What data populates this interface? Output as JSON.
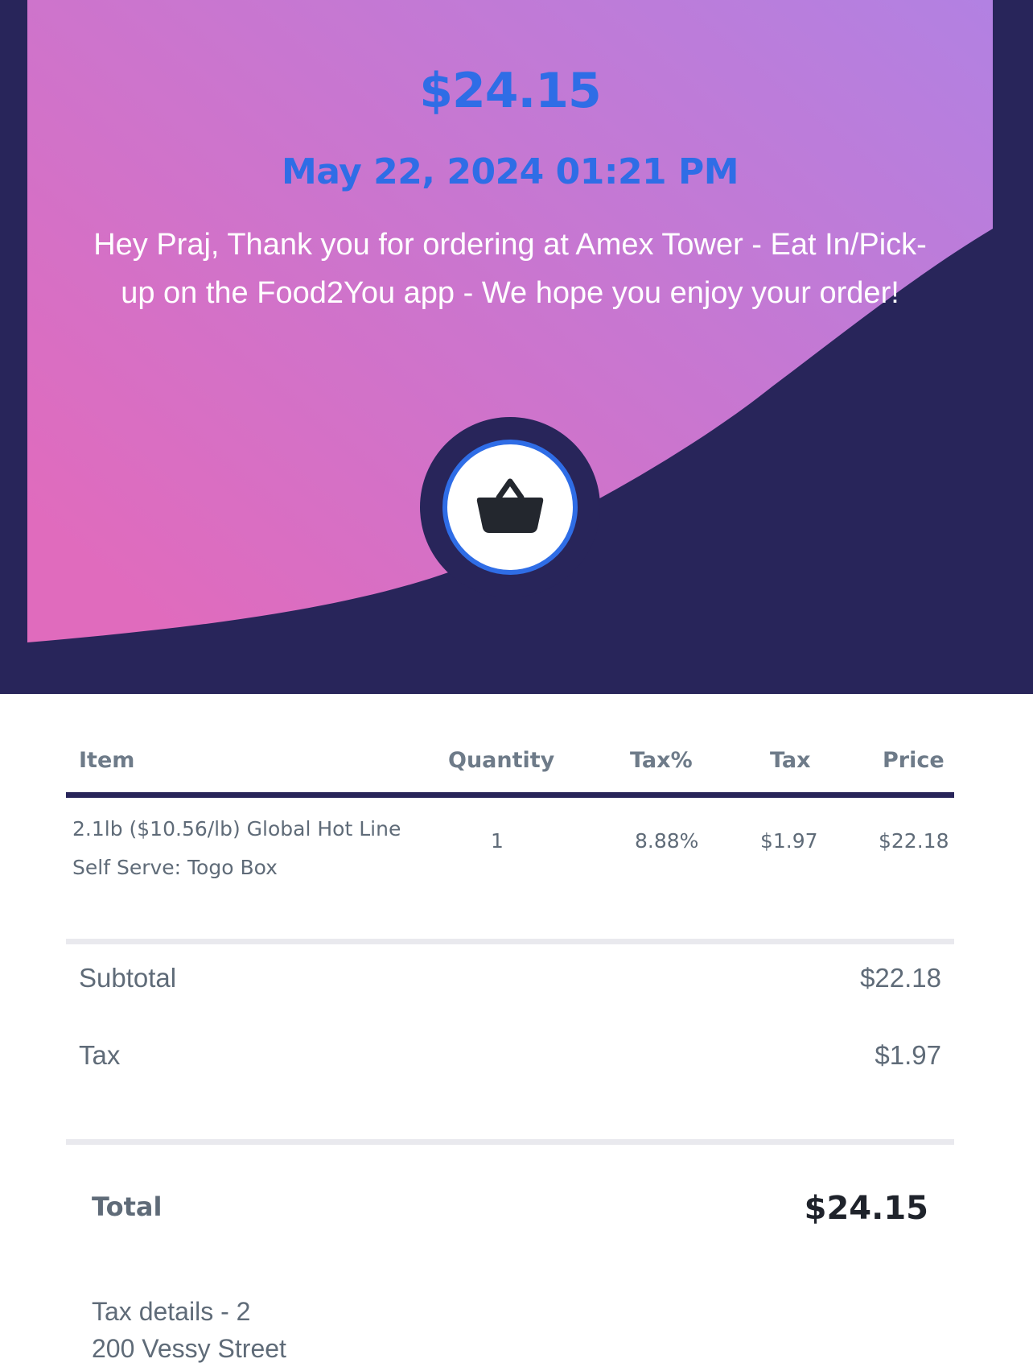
{
  "colors": {
    "navy": "#28255a",
    "accent_blue": "#2f6de6",
    "gradient_start": "#e06bbd",
    "gradient_end": "#b281e2",
    "muted_text": "#5f6b78",
    "dark_text": "#1f232b"
  },
  "hero": {
    "amount": "$24.15",
    "datetime": "May 22, 2024 01:21 PM",
    "message": "Hey Praj, Thank you for ordering at Amex Tower - Eat In/Pick-up on the Food2You app - We hope you enjoy your order!",
    "icon": "shopping-basket-icon"
  },
  "table": {
    "headers": {
      "item": "Item",
      "quantity": "Quantity",
      "tax_percent": "Tax%",
      "tax": "Tax",
      "price": "Price"
    },
    "rows": [
      {
        "item": "2.1lb ($10.56/lb) Global Hot Line Self Serve: Togo Box",
        "quantity": "1",
        "tax_percent": "8.88%",
        "tax": "$1.97",
        "price": "$22.18"
      }
    ]
  },
  "summary": {
    "subtotal_label": "Subtotal",
    "subtotal_value": "$22.18",
    "tax_label": "Tax",
    "tax_value": "$1.97"
  },
  "total": {
    "label": "Total",
    "value": "$24.15"
  },
  "tax_details": {
    "line1": "Tax details - 2",
    "line2": "200 Vessy Street"
  }
}
